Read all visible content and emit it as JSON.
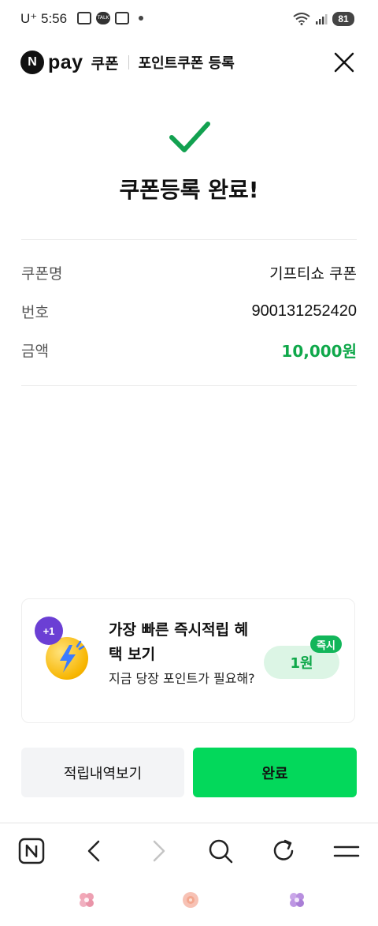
{
  "status_bar": {
    "carrier": "U⁺",
    "time": "5:56",
    "talk_label": "TALK",
    "battery": "81"
  },
  "header": {
    "logo_letter": "N",
    "brand": "pay",
    "brand_section": "쿠폰",
    "title": "포인트쿠폰 등록"
  },
  "result": {
    "title": "쿠폰등록 완료!"
  },
  "details": [
    {
      "label": "쿠폰명",
      "value": "기프티쇼 쿠폰"
    },
    {
      "label": "번호",
      "value": "900131252420"
    },
    {
      "label": "금액",
      "value": "10,000원"
    }
  ],
  "promo": {
    "badge": "+1",
    "title": "가장 빠른 즉시적립 혜택 보기",
    "subtitle": "지금 당장 포인트가 필요해?",
    "reward": "1원",
    "reward_tag": "즉시"
  },
  "buttons": {
    "history": "적립내역보기",
    "done": "완료"
  },
  "colors": {
    "accent_green": "#03d85b",
    "amount_green": "#0fa84a",
    "check_green": "#12a150",
    "promo_badge": "#6b3fd4"
  },
  "icons": {
    "close": "close-icon",
    "check": "check-icon",
    "nav": [
      "naver-home-icon",
      "back-icon",
      "forward-icon",
      "search-icon",
      "refresh-icon",
      "menu-icon"
    ]
  }
}
